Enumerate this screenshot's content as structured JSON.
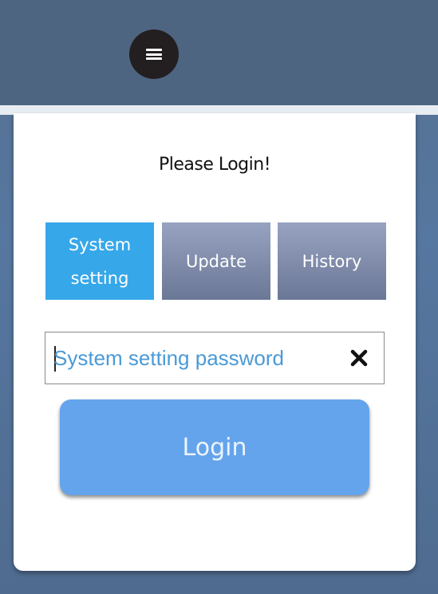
{
  "header": {
    "menu_icon": "hamburger-menu-icon"
  },
  "panel": {
    "title": "Please Login!",
    "tabs": [
      {
        "label": "System setting",
        "active": true
      },
      {
        "label": "Update",
        "active": false
      },
      {
        "label": "History",
        "active": false
      }
    ],
    "password": {
      "placeholder": "System setting password",
      "value": "",
      "clear_icon": "close-x-icon"
    },
    "login_label": "Login"
  },
  "colors": {
    "header_bg": "#4d6581",
    "active_tab": "#36a7e9",
    "inactive_tab": "#7d89a8",
    "login_button": "#64a4ec",
    "placeholder_text": "#4a9ad6"
  }
}
